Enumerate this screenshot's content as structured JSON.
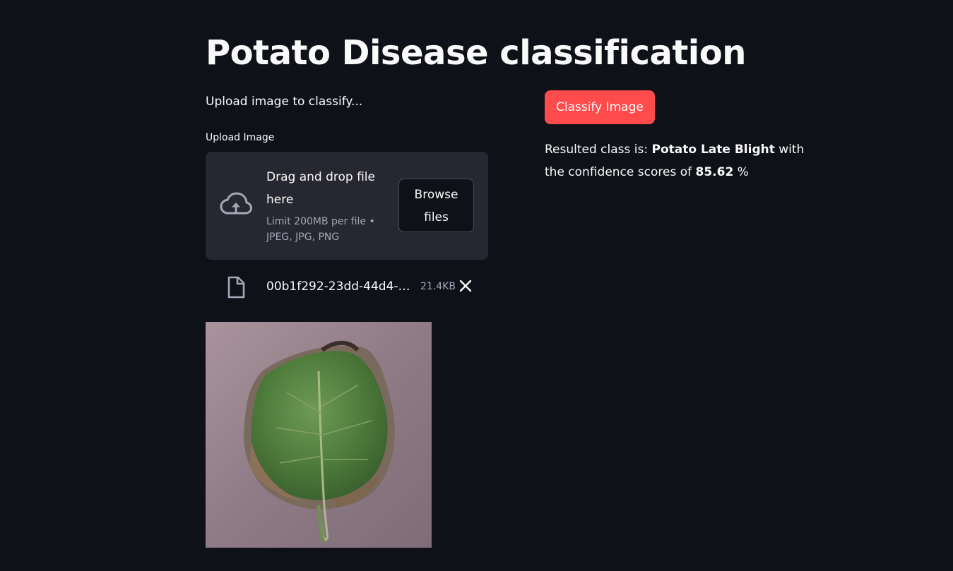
{
  "header": {
    "title": "Potato Disease classification"
  },
  "uploader": {
    "intro_text": "Upload image to classify...",
    "label": "Upload Image",
    "drop_text": "Drag and drop file here",
    "limit_text": "Limit 200MB per file • JPEG, JPG, PNG",
    "browse_label": "Browse files",
    "cloud_icon": "cloud-upload-icon"
  },
  "uploaded_file": {
    "name": "00b1f292-23dd-44d4-a...",
    "size": "21.4KB",
    "file_icon": "file-icon",
    "remove_icon": "close-icon"
  },
  "actions": {
    "classify_label": "Classify Image"
  },
  "result": {
    "prefix": "Resulted class is: ",
    "class_name": "Potato Late Blight",
    "middle": " with the confidence scores of ",
    "confidence": "85.62",
    "suffix": " %"
  },
  "colors": {
    "background": "#0e1117",
    "panel": "#262730",
    "primary_button": "#ff4b4b",
    "muted_text": "#a3a8b8"
  }
}
